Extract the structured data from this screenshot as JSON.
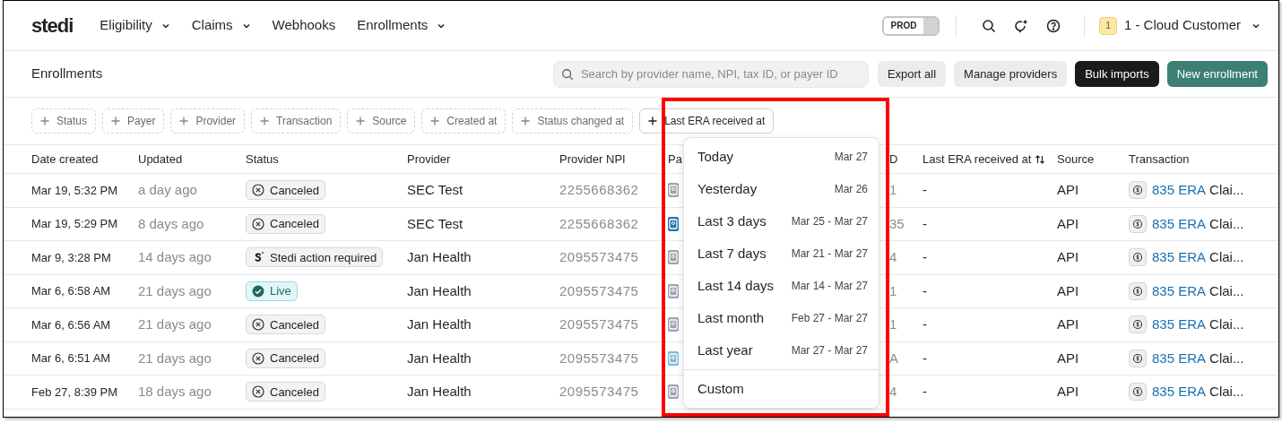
{
  "nav": {
    "logo": "stedi",
    "items": [
      {
        "label": "Eligibility",
        "has_menu": true
      },
      {
        "label": "Claims",
        "has_menu": true
      },
      {
        "label": "Webhooks",
        "has_menu": false
      },
      {
        "label": "Enrollments",
        "has_menu": true
      }
    ],
    "environment": {
      "label": "PROD",
      "on": false
    },
    "account": {
      "badge": "1",
      "name": "1 - Cloud Customer"
    }
  },
  "toolbar": {
    "title": "Enrollments",
    "search": {
      "placeholder": "Search by provider name, NPI, tax ID, or payer ID"
    },
    "buttons": [
      {
        "label": "Export all",
        "kind": "secondary"
      },
      {
        "label": "Manage providers",
        "kind": "secondary"
      },
      {
        "label": "Bulk imports",
        "kind": "dark"
      },
      {
        "label": "New enrollment",
        "kind": "primary"
      }
    ]
  },
  "filters": [
    {
      "label": "Status",
      "active": false
    },
    {
      "label": "Payer",
      "active": false
    },
    {
      "label": "Provider",
      "active": false
    },
    {
      "label": "Transaction",
      "active": false
    },
    {
      "label": "Source",
      "active": false
    },
    {
      "label": "Created at",
      "active": false
    },
    {
      "label": "Status changed at",
      "active": false
    },
    {
      "label": "Last ERA received at",
      "active": true
    }
  ],
  "table": {
    "columns": [
      {
        "label": "Date created",
        "sortable": false
      },
      {
        "label": "Updated",
        "sortable": false
      },
      {
        "label": "Status",
        "sortable": false
      },
      {
        "label": "Provider",
        "sortable": false
      },
      {
        "label": "Provider NPI",
        "sortable": false
      },
      {
        "label": "Pa",
        "sortable": false
      },
      {
        "label": "D",
        "sortable": false
      },
      {
        "label": "Last ERA received at",
        "sortable": true
      },
      {
        "label": "Source",
        "sortable": false
      },
      {
        "label": "Transaction",
        "sortable": false
      }
    ],
    "rows": [
      {
        "date_created": "Mar 19, 5:32 PM",
        "updated": "a day ago",
        "status": {
          "label": "Canceled",
          "kind": "canceled"
        },
        "provider": "SEC Test",
        "npi": "2255668362",
        "payer": {
          "color": "#9ca3af"
        },
        "column_7": "1",
        "last_era": "-",
        "source": "API",
        "transaction": {
          "link": "835 ERA",
          "text": "Clai..."
        }
      },
      {
        "date_created": "Mar 19, 5:29 PM",
        "updated": "8 days ago",
        "status": {
          "label": "Canceled",
          "kind": "canceled"
        },
        "provider": "SEC Test",
        "npi": "2255668362",
        "payer": {
          "color": "#1f77b4"
        },
        "column_7": "35",
        "last_era": "-",
        "source": "API",
        "transaction": {
          "link": "835 ERA",
          "text": "Clai..."
        }
      },
      {
        "date_created": "Mar 9, 3:28 PM",
        "updated": "14 days ago",
        "status": {
          "label": "Stedi action required",
          "kind": "action"
        },
        "provider": "Jan Health",
        "npi": "2095573475",
        "payer": {
          "color": "#9ca3af"
        },
        "column_7": "4",
        "last_era": "-",
        "source": "API",
        "transaction": {
          "link": "835 ERA",
          "text": "Clai..."
        }
      },
      {
        "date_created": "Mar 6, 6:58 AM",
        "updated": "21 days ago",
        "status": {
          "label": "Live",
          "kind": "live"
        },
        "provider": "Jan Health",
        "npi": "2095573475",
        "payer": {
          "color": "#9ca3af"
        },
        "column_7": "1",
        "last_era": "-",
        "source": "API",
        "transaction": {
          "link": "835 ERA",
          "text": "Clai..."
        }
      },
      {
        "date_created": "Mar 6, 6:56 AM",
        "updated": "21 days ago",
        "status": {
          "label": "Canceled",
          "kind": "canceled"
        },
        "provider": "Jan Health",
        "npi": "2095573475",
        "payer": {
          "color": "#9ca3af"
        },
        "column_7": "1",
        "last_era": "-",
        "source": "API",
        "transaction": {
          "link": "835 ERA",
          "text": "Clai..."
        }
      },
      {
        "date_created": "Mar 6, 6:51 AM",
        "updated": "21 days ago",
        "status": {
          "label": "Canceled",
          "kind": "canceled"
        },
        "provider": "Jan Health",
        "npi": "2095573475",
        "payer": {
          "color": "#7fb8d8"
        },
        "column_7": "A",
        "last_era": "-",
        "source": "API",
        "transaction": {
          "link": "835 ERA",
          "text": "Clai..."
        }
      },
      {
        "date_created": "Feb 27, 8:39 PM",
        "updated": "18 days ago",
        "status": {
          "label": "Canceled",
          "kind": "canceled"
        },
        "provider": "Jan Health",
        "npi": "2095573475",
        "payer": {
          "color": "#9ca3af"
        },
        "column_7": "4",
        "last_era": "-",
        "source": "API",
        "transaction": {
          "link": "835 ERA",
          "text": "Clai..."
        }
      }
    ]
  },
  "date_menu": {
    "highlighted": true,
    "options": [
      {
        "label": "Today",
        "range": "Mar 27"
      },
      {
        "label": "Yesterday",
        "range": "Mar 26"
      },
      {
        "label": "Last 3 days",
        "range": "Mar 25 - Mar 27"
      },
      {
        "label": "Last 7 days",
        "range": "Mar 21 - Mar 27"
      },
      {
        "label": "Last 14 days",
        "range": "Mar 14 - Mar 27"
      },
      {
        "label": "Last month",
        "range": "Feb 27 - Mar 27"
      },
      {
        "label": "Last year",
        "range": "Mar 27 - Mar 27"
      }
    ],
    "custom": "Custom"
  }
}
